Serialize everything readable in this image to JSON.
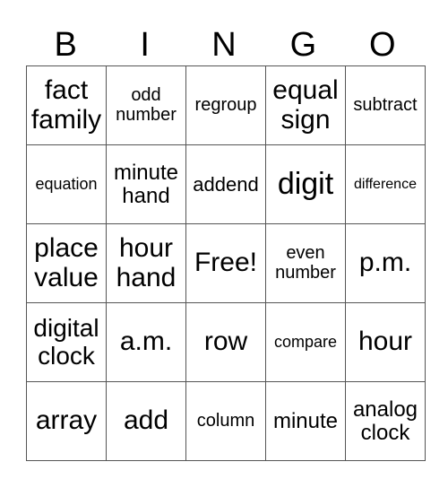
{
  "header": [
    "B",
    "I",
    "N",
    "G",
    "O"
  ],
  "rows": [
    [
      "fact family",
      "odd number",
      "regroup",
      "equal sign",
      "subtract"
    ],
    [
      "equation",
      "minute hand",
      "addend",
      "digit",
      "difference"
    ],
    [
      "place value",
      "hour hand",
      "Free!",
      "even number",
      "p.m."
    ],
    [
      "digital clock",
      "a.m.",
      "row",
      "compare",
      "hour"
    ],
    [
      "array",
      "add",
      "column",
      "minute",
      "analog clock"
    ]
  ]
}
